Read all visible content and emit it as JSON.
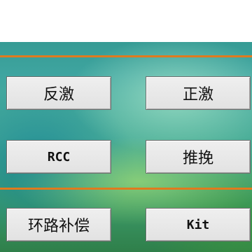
{
  "buttons": {
    "flyback": "反激",
    "forward": "正激",
    "rcc": "RCC",
    "push_pull": "推挽",
    "loop_compensation": "环路补偿",
    "kit": "Kit"
  },
  "colors": {
    "divider": "#e07a1e",
    "button_face": "#e6e6e6"
  }
}
